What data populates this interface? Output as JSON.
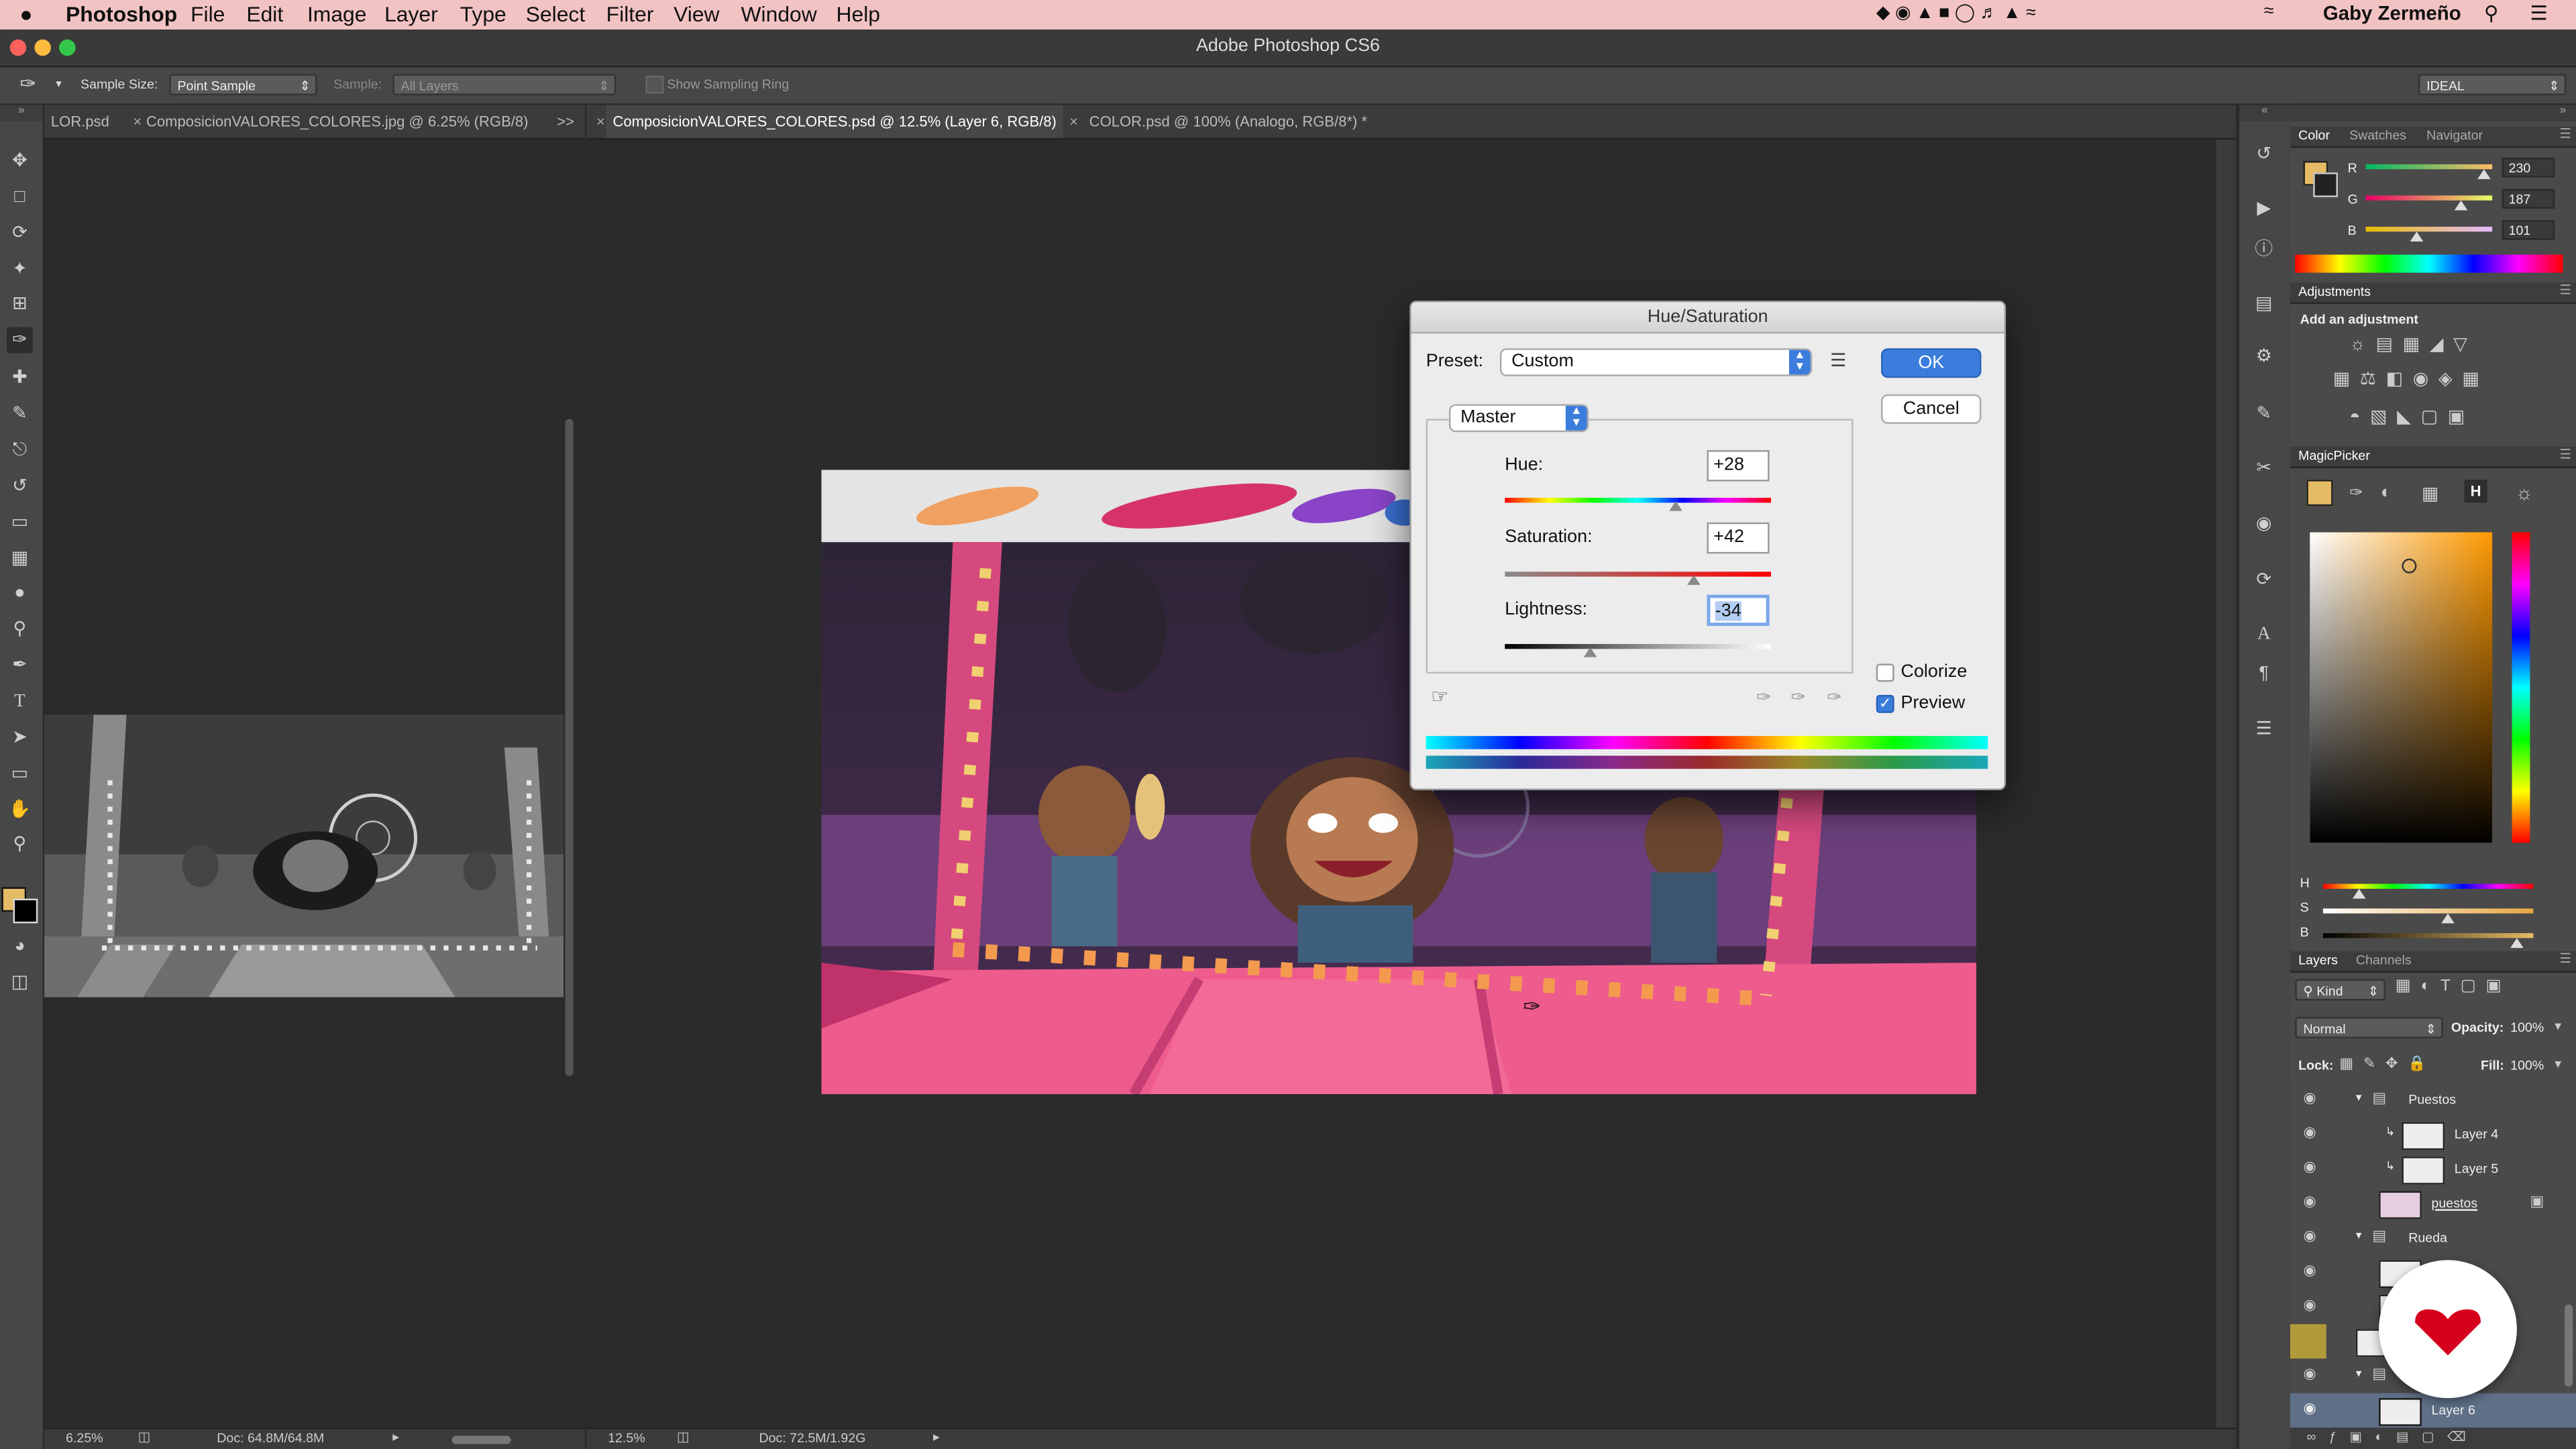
{
  "menubar": {
    "apple": "",
    "app": "Photoshop",
    "items": [
      "File",
      "Edit",
      "Image",
      "Layer",
      "Type",
      "Select",
      "Filter",
      "View",
      "Window",
      "Help"
    ],
    "user": "Gaby Zermeño"
  },
  "window": {
    "title": "Adobe Photoshop CS6"
  },
  "options": {
    "sample_size_label": "Sample Size:",
    "sample_size_value": "Point Sample",
    "sample_label": "Sample:",
    "sample_value": "All Layers",
    "sampling_ring_label": "Show Sampling Ring",
    "workspace": "IDEAL"
  },
  "tabs_left": {
    "t0": "LOR.psd",
    "t1": "ComposicionVALORES_COLORES.jpg @ 6.25% (RGB/8)",
    "more": ">>"
  },
  "tabs_right": {
    "t0": "ComposicionVALORES_COLORES.psd @ 12.5% (Layer 6, RGB/8)",
    "t1": "COLOR.psd @ 100% (Analogo, RGB/8*) *"
  },
  "status_left": {
    "zoom": "6.25%",
    "doc": "Doc: 64.8M/64.8M"
  },
  "status_right": {
    "zoom": "12.5%",
    "doc": "Doc: 72.5M/1.92G"
  },
  "dialog": {
    "title": "Hue/Saturation",
    "preset_label": "Preset:",
    "preset_value": "Custom",
    "channel": "Master",
    "hue_label": "Hue:",
    "hue_value": "+28",
    "sat_label": "Saturation:",
    "sat_value": "+42",
    "light_label": "Lightness:",
    "light_value": "-34",
    "ok": "OK",
    "cancel": "Cancel",
    "colorize": "Colorize",
    "preview": "Preview"
  },
  "color_panel": {
    "tabs": [
      "Color",
      "Swatches",
      "Navigator"
    ],
    "r_label": "R",
    "r": "230",
    "g_label": "G",
    "g": "187",
    "b_label": "B",
    "b": "101",
    "fg_color": "#e6bb65"
  },
  "adjustments": {
    "title": "Adjustments",
    "subtitle": "Add an adjustment"
  },
  "magicpicker": {
    "title": "MagicPicker",
    "h_label": "H",
    "s_label": "S",
    "b_label": "B",
    "mode_badge": "H"
  },
  "layers": {
    "tabs": [
      "Layers",
      "Channels"
    ],
    "kind": "Kind",
    "blend": "Normal",
    "opacity_label": "Opacity:",
    "opacity": "100%",
    "lock_label": "Lock:",
    "fill_label": "Fill:",
    "fill": "100%",
    "rows": [
      {
        "name": "Puestos"
      },
      {
        "name": "Layer 4"
      },
      {
        "name": "Layer 5"
      },
      {
        "name": "puestos"
      },
      {
        "name": "Rueda"
      },
      {
        "name": ""
      },
      {
        "name": ""
      },
      {
        "name": ""
      },
      {
        "name": ""
      },
      {
        "name": "Layer 6"
      }
    ]
  },
  "colors": {
    "menubar_bg": "#f2c3c3",
    "ok_button": "#3b7ddd",
    "brand_badge": "#d6001c"
  }
}
